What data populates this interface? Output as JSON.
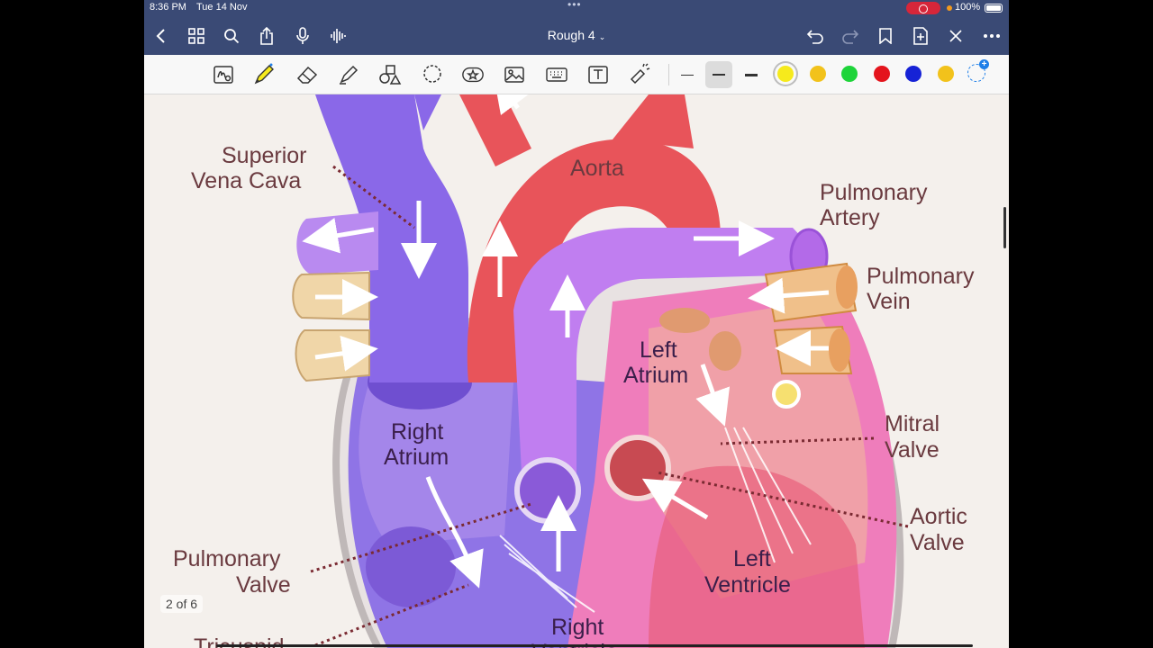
{
  "status": {
    "time": "8:36 PM",
    "date": "Tue 14 Nov",
    "battery": "100%"
  },
  "nav": {
    "title": "Rough 4",
    "icons": [
      "back-icon",
      "grid-icon",
      "search-icon",
      "share-icon",
      "microphone-icon",
      "audio-wave-icon",
      "undo-icon",
      "redo-icon",
      "bookmark-icon",
      "add-page-icon",
      "close-icon",
      "more-icon"
    ]
  },
  "toolbar": {
    "tools": [
      "lasso-handwriting-icon",
      "pen-icon",
      "eraser-icon",
      "highlighter-icon",
      "shapes-icon",
      "lasso-icon",
      "sticker-icon",
      "image-icon",
      "keyboard-icon",
      "text-box-icon",
      "laser-pointer-icon"
    ],
    "colors": [
      "#f6ea1c",
      "#f2c21b",
      "#1ed43a",
      "#e4141c",
      "#1622d6",
      "#f2c21b"
    ],
    "selected_color": "#f6ea1c"
  },
  "diagram": {
    "labels": {
      "superior_vena_cava_1": "Superior",
      "superior_vena_cava_2": "Vena Cava",
      "aorta": "Aorta",
      "pulmonary_artery_1": "Pulmonary",
      "pulmonary_artery_2": "Artery",
      "pulmonary_vein_1": "Pulmonary",
      "pulmonary_vein_2": "Vein",
      "left_atrium_1": "Left",
      "left_atrium_2": "Atrium",
      "right_atrium_1": "Right",
      "right_atrium_2": "Atrium",
      "mitral_valve_1": "Mitral",
      "mitral_valve_2": "Valve",
      "aortic_valve_1": "Aortic",
      "aortic_valve_2": "Valve",
      "pulmonary_valve_1": "Pulmonary",
      "pulmonary_valve_2": "Valve",
      "left_ventricle_1": "Left",
      "left_ventricle_2": "Ventricle",
      "right_ventricle_1": "Right",
      "right_ventricle_2": "Ventricle",
      "tricuspid": "Tricuspid"
    }
  },
  "page_indicator": "2 of 6"
}
